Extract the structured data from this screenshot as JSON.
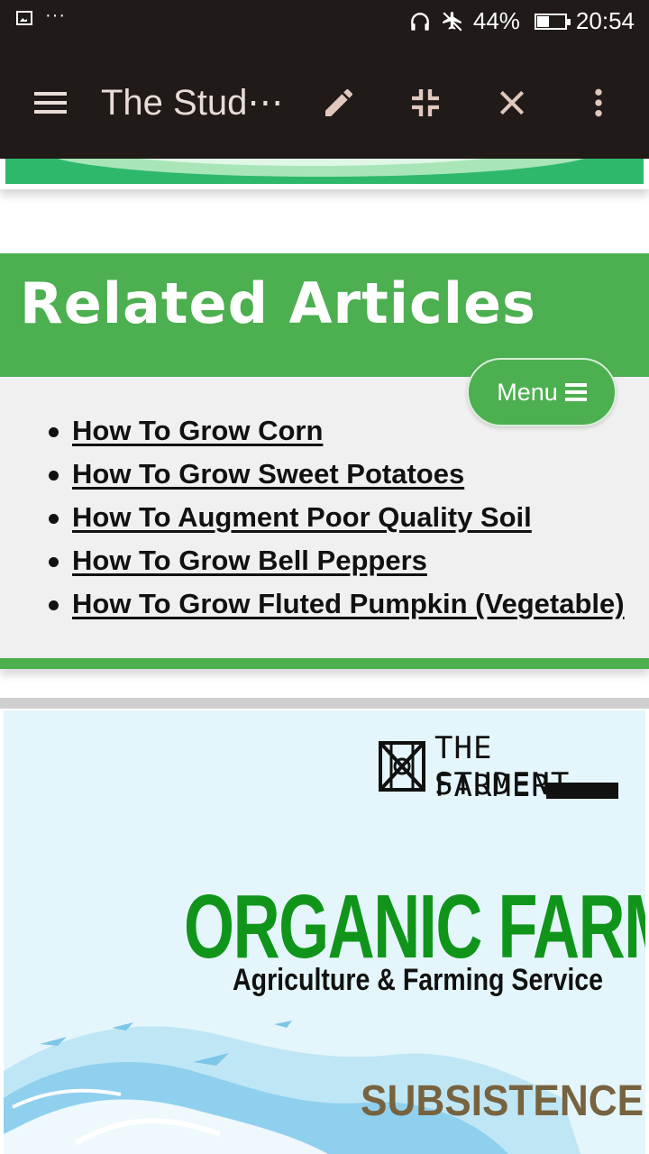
{
  "status_bar": {
    "battery_percent": "44%",
    "battery_level": 0.44,
    "time": "20:54",
    "icons": [
      "image-icon",
      "more-dots-icon",
      "headphones-icon",
      "airplane-mode-icon",
      "battery-icon"
    ]
  },
  "app_bar": {
    "title": "The Stud⋯",
    "icons": [
      "menu-icon",
      "edit-icon",
      "collapse-icon",
      "close-icon",
      "overflow-menu-icon"
    ]
  },
  "related": {
    "heading": "Related Articles",
    "items": [
      {
        "label": "How To Grow Corn"
      },
      {
        "label": "How To Grow Sweet Potatoes"
      },
      {
        "label": "How To Augment Poor Quality Soil"
      },
      {
        "label": "How To Grow Bell Peppers"
      },
      {
        "label": "How To Grow Fluted Pumpkin (Vegetable)"
      }
    ]
  },
  "menu_button": {
    "label": "Menu",
    "icon": "hamburger-icon"
  },
  "banner": {
    "brand_line1": "THE STUDENT",
    "brand_line2": "FARMER",
    "headline": "ORGANIC FARM",
    "tagline": "Agriculture & Farming Service",
    "footer_word": "SUBSISTENCE",
    "colors": {
      "headline": "#10951a",
      "footer_word": "#77633f",
      "background": "#e4f6fb"
    }
  },
  "colors": {
    "accent_green": "#4caf50",
    "app_bar": "#201a19"
  }
}
